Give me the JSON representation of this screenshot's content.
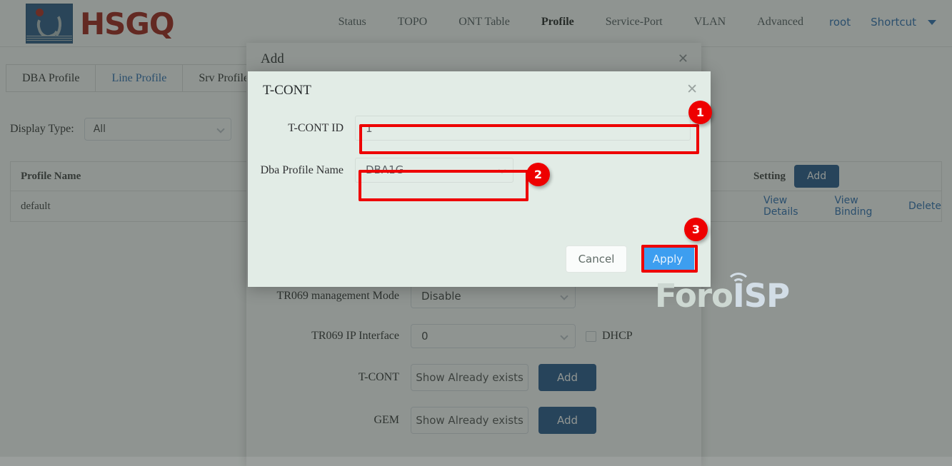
{
  "brand": {
    "name": "HSGQ",
    "logo_icon": "hsgq-logo-icon"
  },
  "nav": {
    "items": [
      {
        "label": "Status",
        "active": false
      },
      {
        "label": "TOPO",
        "active": false
      },
      {
        "label": "ONT Table",
        "active": false
      },
      {
        "label": "Profile",
        "active": true
      },
      {
        "label": "Service-Port",
        "active": false
      },
      {
        "label": "VLAN",
        "active": false
      },
      {
        "label": "Advanced",
        "active": false
      }
    ],
    "user": "root",
    "shortcut": "Shortcut",
    "shortcut_icon": "chevron-down-icon"
  },
  "tabs": [
    {
      "label": "DBA Profile",
      "active": false
    },
    {
      "label": "Line Profile",
      "active": true
    },
    {
      "label": "Srv Profile",
      "active": false
    }
  ],
  "filter": {
    "label": "Display Type:",
    "value": "All",
    "chevron_icon": "chevron-down-icon"
  },
  "table": {
    "headers": {
      "name": "Profile Name",
      "setting": "Setting"
    },
    "add_label": "Add",
    "rows": [
      {
        "name": "default",
        "actions": [
          "View Details",
          "View Binding",
          "Delete"
        ]
      }
    ]
  },
  "add_dialog": {
    "title": "Add",
    "close_icon": "close-icon",
    "fields": [
      {
        "label": "TR069 management Mode",
        "value": "Disable",
        "type": "select"
      },
      {
        "label": "TR069 IP Interface",
        "value": "0",
        "type": "select",
        "checkbox": "DHCP"
      },
      {
        "label": "T-CONT",
        "value": "Show Already exists",
        "type": "button",
        "add": "Add"
      },
      {
        "label": "GEM",
        "value": "Show Already exists",
        "type": "button",
        "add": "Add"
      }
    ],
    "chevron_icon": "chevron-down-icon"
  },
  "tcont_dialog": {
    "title": "T-CONT",
    "close_icon": "close-icon",
    "tcont_id": {
      "label": "T-CONT ID",
      "value": "1",
      "placeholder": ""
    },
    "dba_profile": {
      "label": "Dba Profile Name",
      "value": "DBA1G",
      "chevron_icon": "chevron-down-icon"
    },
    "cancel_label": "Cancel",
    "apply_label": "Apply"
  },
  "watermark": {
    "part1": "Foro",
    "part2": "ISP"
  },
  "annotations": {
    "badges": [
      "1",
      "2",
      "3"
    ],
    "color": "#ee0000"
  }
}
